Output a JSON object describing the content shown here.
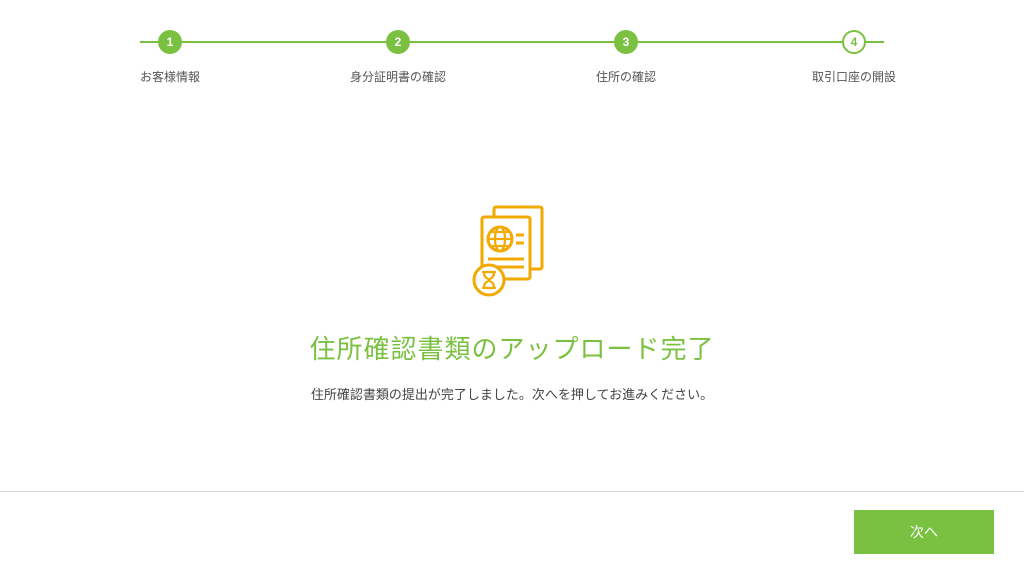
{
  "stepper": {
    "steps": [
      {
        "number": "1",
        "label": "お客様情報"
      },
      {
        "number": "2",
        "label": "身分証明書の確認"
      },
      {
        "number": "3",
        "label": "住所の確認"
      },
      {
        "number": "4",
        "label": "取引口座の開設"
      }
    ]
  },
  "main": {
    "headline": "住所確認書類のアップロード完了",
    "subtext": "住所確認書類の提出が完了しました。次へを押してお進みください。"
  },
  "footer": {
    "next_label": "次へ"
  },
  "icons": {
    "document": "document-pending-icon"
  },
  "colors": {
    "accent": "#7ac142",
    "highlight": "#f2a900"
  }
}
